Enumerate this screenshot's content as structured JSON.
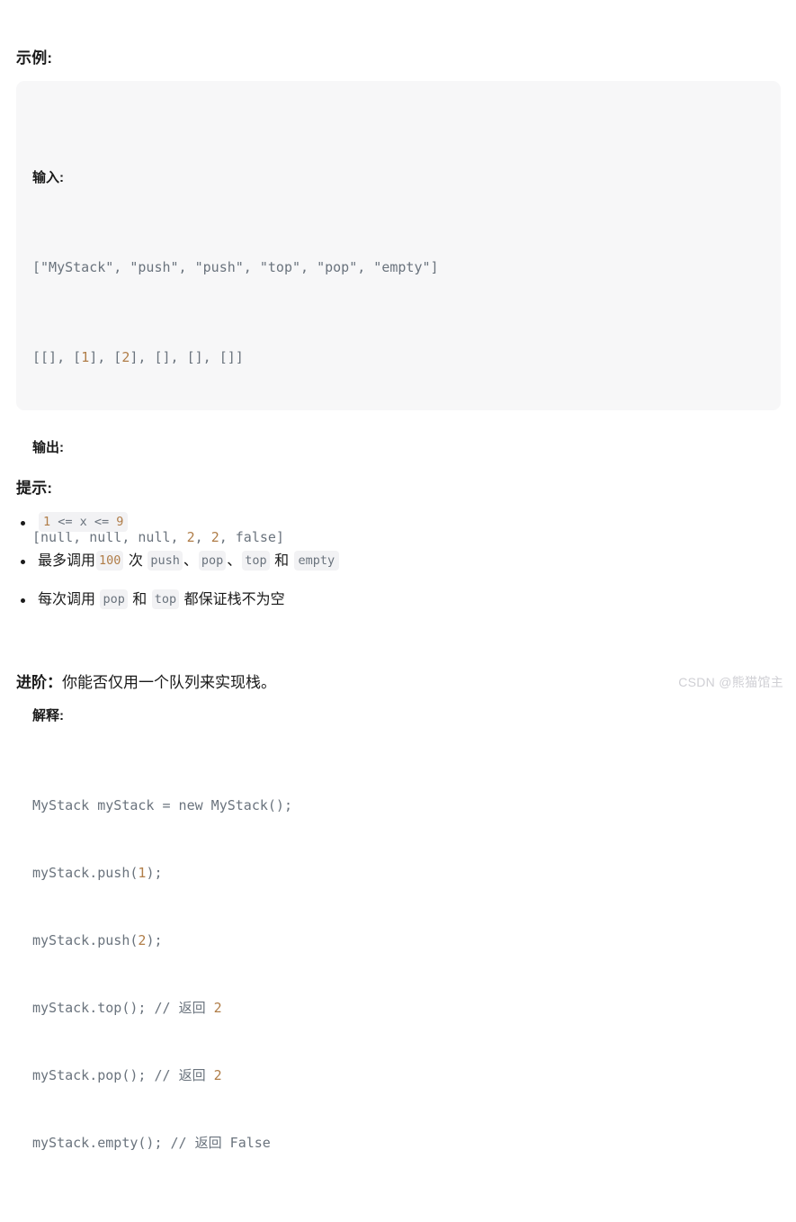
{
  "sections": {
    "example_heading": "示例:",
    "hints_heading": "提示:"
  },
  "example_block": {
    "input_label": "输入:",
    "input_lines": [
      "[\"MyStack\", \"push\", \"push\", \"top\", \"pop\", \"empty\"]",
      "[[], [1], [2], [], [], []]"
    ],
    "output_label": "输出:",
    "output_lines": [
      "[null, null, null, 2, 2, false]"
    ],
    "explain_label": "解释:",
    "explain_lines": [
      "MyStack myStack = new MyStack();",
      "myStack.push(1);",
      "myStack.push(2);",
      "myStack.top(); // 返回 2",
      "myStack.pop(); // 返回 2",
      "myStack.empty(); // 返回 False"
    ]
  },
  "hints": [
    {
      "id": "range",
      "parts": [
        {
          "type": "code",
          "text": "1 <= x <= 9"
        }
      ]
    },
    {
      "id": "call-count",
      "parts": [
        {
          "type": "text",
          "text": "最多调用"
        },
        {
          "type": "code",
          "text": "100"
        },
        {
          "type": "text",
          "text": " 次 "
        },
        {
          "type": "code",
          "text": "push"
        },
        {
          "type": "text",
          "text": "、"
        },
        {
          "type": "code",
          "text": "pop"
        },
        {
          "type": "text",
          "text": "、"
        },
        {
          "type": "code",
          "text": "top"
        },
        {
          "type": "text",
          "text": " 和 "
        },
        {
          "type": "code",
          "text": "empty"
        }
      ]
    },
    {
      "id": "non-empty",
      "parts": [
        {
          "type": "text",
          "text": "每次调用 "
        },
        {
          "type": "code",
          "text": "pop"
        },
        {
          "type": "text",
          "text": " 和 "
        },
        {
          "type": "code",
          "text": "top"
        },
        {
          "type": "text",
          "text": " 都保证栈不为空"
        }
      ]
    }
  ],
  "followup": {
    "label": "进阶：",
    "text": "你能否仅用一个队列来实现栈。"
  },
  "watermark": {
    "text": "CSDN @熊猫馆主"
  },
  "colors": {
    "page_background": "#ffffff",
    "code_block_background": "#f7f7f8",
    "inline_code_background": "#f2f2f4",
    "code_text": "#6a737d",
    "number_literal": "#b07d48",
    "body_text": "#1a1a1a",
    "watermark_text": "#cfcfd4"
  }
}
